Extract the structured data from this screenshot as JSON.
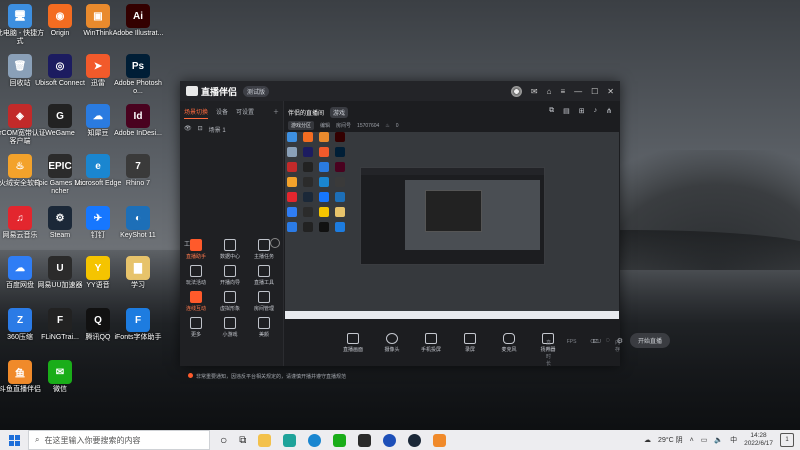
{
  "desktop": {
    "icons": [
      {
        "label": "此电脑 - 快捷方式",
        "color": "#3d8fe0",
        "glyph": "🖥"
      },
      {
        "label": "Origin",
        "color": "#f36c21",
        "glyph": "◉"
      },
      {
        "label": "WinThink",
        "color": "#e98a2d",
        "glyph": "▣"
      },
      {
        "label": "Adobe Illustrat...",
        "color": "#330000",
        "glyph": "Ai"
      },
      {
        "label": "回收站",
        "color": "#8aa0b8",
        "glyph": "🗑"
      },
      {
        "label": "Ubisoft Connect",
        "color": "#1c1c60",
        "glyph": "◎"
      },
      {
        "label": "迅雷",
        "color": "#f25a2b",
        "glyph": "➤"
      },
      {
        "label": "Adobe Photosho...",
        "color": "#001e36",
        "glyph": "Ps"
      },
      {
        "label": "DrCOM宽带认证客户端",
        "color": "#c22a2a",
        "glyph": "◈"
      },
      {
        "label": "WeGame",
        "color": "#222",
        "glyph": "G"
      },
      {
        "label": "知犀豆",
        "color": "#2a7be0",
        "glyph": "☁"
      },
      {
        "label": "Adobe InDesi...",
        "color": "#49021f",
        "glyph": "Id"
      },
      {
        "label": "火绒安全软件",
        "color": "#f3a22b",
        "glyph": "♨"
      },
      {
        "label": "Epic Games Launcher",
        "color": "#2b2b2b",
        "glyph": "EPIC"
      },
      {
        "label": "Microsoft Edge",
        "color": "#1a86d0",
        "glyph": "e"
      },
      {
        "label": "Rhino 7",
        "color": "#3a3a3a",
        "glyph": "7"
      },
      {
        "label": "网易云音乐",
        "color": "#e3262e",
        "glyph": "♫"
      },
      {
        "label": "Steam",
        "color": "#1b2838",
        "glyph": "⚙"
      },
      {
        "label": "钉钉",
        "color": "#1677ff",
        "glyph": "✈"
      },
      {
        "label": "KeyShot 11",
        "color": "#1d6fb8",
        "glyph": "◐"
      },
      {
        "label": "百度网盘",
        "color": "#2f7df5",
        "glyph": "☁"
      },
      {
        "label": "网易UU加速器",
        "color": "#2b2b2b",
        "glyph": "U"
      },
      {
        "label": "YY语音",
        "color": "#f5c400",
        "glyph": "Y"
      },
      {
        "label": "学习",
        "color": "#e7c36b",
        "glyph": "▇"
      },
      {
        "label": "360压缩",
        "color": "#2b7be6",
        "glyph": "Z"
      },
      {
        "label": "FLiNGTrai...",
        "color": "#222",
        "glyph": "F"
      },
      {
        "label": "腾讯QQ",
        "color": "#111",
        "glyph": "Q"
      },
      {
        "label": "iFonts字体助手",
        "color": "#1d7ce0",
        "glyph": "F"
      },
      {
        "label": "斗鱼直播伴侣",
        "color": "#f08a2a",
        "glyph": "鱼"
      },
      {
        "label": "微信",
        "color": "#1aad19",
        "glyph": "✉"
      }
    ]
  },
  "app": {
    "name": "直播伴侣",
    "badge": "测试版",
    "left_tabs": [
      "场景切换",
      "设备",
      "可设置"
    ],
    "scene_name": "场景 1",
    "tools_title": "工具箱",
    "tools": [
      {
        "label": "直播助手",
        "hot": true
      },
      {
        "label": "数据中心",
        "hot": false
      },
      {
        "label": "主播任务",
        "hot": false
      },
      {
        "label": "玩法活动",
        "hot": false
      },
      {
        "label": "开播向导",
        "hot": false
      },
      {
        "label": "直播工具",
        "hot": false
      },
      {
        "label": "连线互动",
        "hot": true
      },
      {
        "label": "虚拟形象",
        "hot": false
      },
      {
        "label": "房间管理",
        "hot": false
      },
      {
        "label": "更多",
        "hot": false
      },
      {
        "label": "小游戏",
        "hot": false
      },
      {
        "label": "美颜",
        "hot": false
      }
    ],
    "notice": "非常重要通知，因违反平台相关规定的，请谨慎开播并遵守直播规范",
    "main": {
      "room_title": "伴侣的直播间",
      "room_tag": "游戏",
      "category_chip": "游戏分区",
      "meta_edit": "编辑",
      "room_id_label": "房间号",
      "room_id": "15707604",
      "hot_value": "0"
    },
    "controls": [
      "直播画面",
      "摄像头",
      "手机投屏",
      "录屏",
      "麦克风",
      "扬声器"
    ],
    "go_live": "开始直播",
    "status": [
      "直播时长",
      "FPS",
      "CPU",
      "内存"
    ]
  },
  "taskbar": {
    "search_placeholder": "在这里输入你要搜索的内容",
    "weather": "29°C 阴",
    "ime": "中",
    "time": "14:28",
    "date": "2022/6/17",
    "notif_count": "1"
  },
  "colors": {
    "accent": "#ff5a2b",
    "window_bg": "#1c1d20",
    "taskbar_bg": "#ededf0"
  }
}
